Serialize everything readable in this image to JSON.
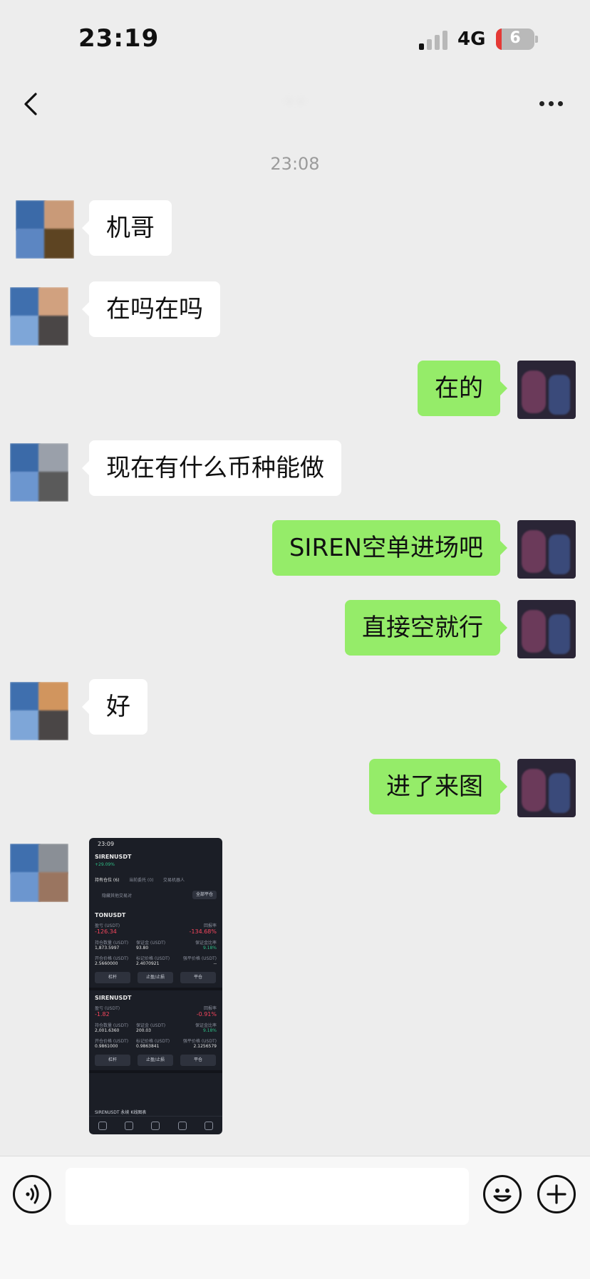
{
  "status_bar": {
    "time": "23:19",
    "network": "4G",
    "battery_level": "6",
    "signal_bars_active": 1
  },
  "nav": {
    "back_icon": "chevron-left-icon",
    "more_icon": "ellipsis-icon"
  },
  "timestamp": "23:08",
  "messages": [
    {
      "side": "left",
      "text": "机哥"
    },
    {
      "side": "left",
      "text": "在吗在吗"
    },
    {
      "side": "right",
      "text": "在的"
    },
    {
      "side": "left",
      "text": "现在有什么币种能做"
    },
    {
      "side": "right",
      "text": "SIREN空单进场吧"
    },
    {
      "side": "right",
      "text": "直接空就行"
    },
    {
      "side": "left",
      "text": "好"
    },
    {
      "side": "right",
      "text": "进了来图"
    },
    {
      "side": "left",
      "type": "image"
    }
  ],
  "image_message": {
    "time": "23:09",
    "symbol": "SIRENUSDT",
    "change": "+29.09%",
    "tabs": [
      "持有仓位 (6)",
      "当前委托 (0)",
      "交易机器人"
    ],
    "hide_label": "隐藏其他交易对",
    "close_all": "全部平仓",
    "positions": [
      {
        "symbol": "TONUSDT",
        "pnl_label": "盈亏 (USDT)",
        "pnl": "-126.34",
        "roe_label": "回报率",
        "roe": "-134.68%",
        "size_label": "持仓数量 (USDT)",
        "size": "1,873.5997",
        "margin_label": "保证金 (USDT)",
        "margin": "93.80",
        "ratio_label": "保证金比率",
        "ratio": "9.18%",
        "entry_label": "开仓价格 (USDT)",
        "entry": "2.5660000",
        "mark_label": "标记价格 (USDT)",
        "mark": "2.4070921",
        "liq_label": "强平价格 (USDT)",
        "liq": "--"
      },
      {
        "symbol": "SIRENUSDT",
        "pnl_label": "盈亏 (USDT)",
        "pnl": "-1.82",
        "roe_label": "回报率",
        "roe": "-0.91%",
        "size_label": "持仓数量 (USDT)",
        "size": "2,001.6360",
        "margin_label": "保证金 (USDT)",
        "margin": "200.03",
        "ratio_label": "保证金比率",
        "ratio": "9.18%",
        "entry_label": "开仓价格 (USDT)",
        "entry": "0.9861000",
        "mark_label": "标记价格 (USDT)",
        "mark": "0.9863841",
        "liq_label": "强平价格 (USDT)",
        "liq": "2.1256579"
      }
    ],
    "buttons": [
      "杠杆",
      "止盈/止损",
      "平仓"
    ],
    "footer": "SIRENUSDT 永续 K线图表",
    "tabbar": [
      "首页",
      "行情",
      "交易",
      "合约",
      "资产"
    ]
  },
  "input_bar": {
    "voice_icon": "voice-icon",
    "emoji_icon": "emoji-icon",
    "plus_icon": "plus-icon",
    "input_value": ""
  }
}
